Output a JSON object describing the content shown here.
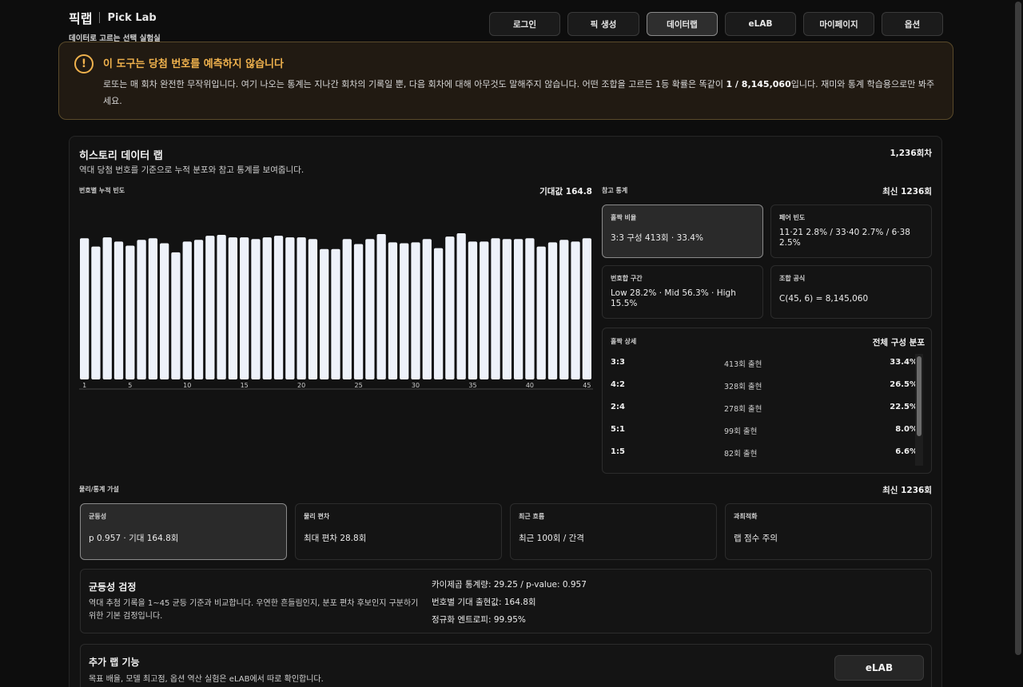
{
  "brand": {
    "name_ko": "픽랩",
    "name_en": "Pick Lab",
    "tagline": "데이터로 고르는 선택 실험실"
  },
  "nav": [
    {
      "label": "로그인",
      "active": false
    },
    {
      "label": "픽 생성",
      "active": false
    },
    {
      "label": "데이터랩",
      "active": true
    },
    {
      "label": "eLAB",
      "active": false
    },
    {
      "label": "마이페이지",
      "active": false
    },
    {
      "label": "옵션",
      "active": false
    }
  ],
  "warning": {
    "icon": "exclamation-icon",
    "title": "이 도구는 당첨 번호를 예측하지 않습니다",
    "body_before": "로또는 매 회차 완전한 무작위입니다. 여기 나오는 통계는 지나간 회차의 기록일 뿐, 다음 회차에 대해 아무것도 말해주지 않습니다. 어떤 조합을 고르든 1등 확률은 똑같이 ",
    "body_bold": "1 / 8,145,060",
    "body_after": "입니다. 재미와 통계 학습용으로만 봐주세요.",
    "accent_color": "#f0b24d"
  },
  "history": {
    "title": "히스토리 데이터 랩",
    "subtitle": "역대 당첨 번호를 기준으로 누적 분포와 참고 통계를 보여줍니다.",
    "rounds": "1,236회차"
  },
  "freq_chart": {
    "label": "번호별 누적 빈도",
    "expected": "기대값 164.8",
    "x_ticks": [
      "1",
      "5",
      "10",
      "15",
      "20",
      "25",
      "30",
      "35",
      "40",
      "45"
    ]
  },
  "chart_data": {
    "type": "bar",
    "categories": [
      "1",
      "2",
      "3",
      "4",
      "5",
      "6",
      "7",
      "8",
      "9",
      "10",
      "11",
      "12",
      "13",
      "14",
      "15",
      "16",
      "17",
      "18",
      "19",
      "20",
      "21",
      "22",
      "23",
      "24",
      "25",
      "26",
      "27",
      "28",
      "29",
      "30",
      "31",
      "32",
      "33",
      "34",
      "35",
      "36",
      "37",
      "38",
      "39",
      "40",
      "41",
      "42",
      "43",
      "44",
      "45"
    ],
    "values": [
      170,
      160,
      171,
      166,
      161,
      168,
      170,
      164,
      153,
      166,
      168,
      173,
      174,
      171,
      171,
      169,
      171,
      173,
      171,
      171,
      169,
      157,
      157,
      169,
      163,
      169,
      175,
      165,
      164,
      165,
      169,
      158,
      172,
      176,
      166,
      166,
      170,
      169,
      169,
      170,
      160,
      165,
      168,
      166,
      170
    ],
    "ylim": [
      0,
      200
    ],
    "bar_color": "#eef2fa"
  },
  "ref_stats": {
    "label": "참고 통계",
    "latest": "최신 1236회",
    "cards": [
      {
        "label": "홀짝 비율",
        "value": "3:3 구성 413회 · 33.4%",
        "active": true
      },
      {
        "label": "페어 빈도",
        "value": "11·21 2.8% / 33·40 2.7% / 6·38 2.5%",
        "active": false
      },
      {
        "label": "번호합 구간",
        "value": "Low 28.2% · Mid 56.3% · High 15.5%",
        "active": false
      },
      {
        "label": "조합 공식",
        "value": "C(45, 6) = 8,145,060",
        "active": false
      }
    ],
    "odd_even": {
      "label": "홀짝 상세",
      "right_label": "전체 구성 분포",
      "rows": [
        {
          "key": "3:3",
          "count": "413회 출현",
          "pct": "33.4%"
        },
        {
          "key": "4:2",
          "count": "328회 출현",
          "pct": "26.5%"
        },
        {
          "key": "2:4",
          "count": "278회 출현",
          "pct": "22.5%"
        },
        {
          "key": "5:1",
          "count": "99회 출현",
          "pct": "8.0%"
        },
        {
          "key": "1:5",
          "count": "82회 출현",
          "pct": "6.6%"
        }
      ]
    }
  },
  "hypotheses": {
    "label": "물리/통계 가설",
    "latest": "최신 1236회",
    "cards": [
      {
        "label": "균등성",
        "value": "p 0.957 · 기대 164.8회",
        "active": true
      },
      {
        "label": "물리 편차",
        "value": "최대 편차 28.8회",
        "active": false
      },
      {
        "label": "최근 흐름",
        "value": "최근 100회 / 간격",
        "active": false
      },
      {
        "label": "과최적화",
        "value": "랩 점수 주의",
        "active": false
      }
    ]
  },
  "uniformity": {
    "title": "균등성 검정",
    "desc": "역대 추첨 기록을 1~45 균등 기준과 비교합니다. 우연한 흔들림인지, 분포 편차 후보인지 구분하기 위한 기본 검정입니다.",
    "stats": [
      "카이제곱 통계량: 29.25 / p-value: 0.957",
      "번호별 기대 출현값: 164.8회",
      "정규화 엔트로피: 99.95%"
    ]
  },
  "extra": {
    "title": "추가 랩 기능",
    "desc": "목표 배율, 모델 최고점, 옵션 역산 실험은 eLAB에서 따로 확인합니다.",
    "button": "eLAB"
  }
}
